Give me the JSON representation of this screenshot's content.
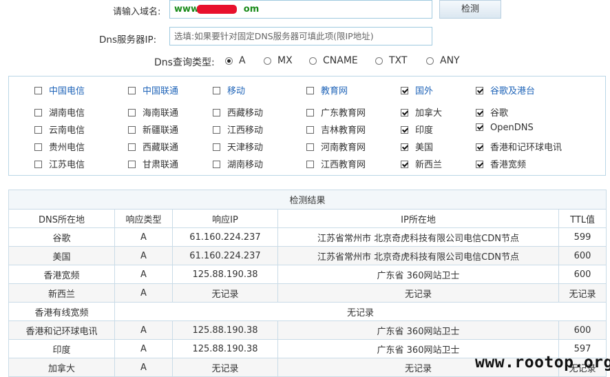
{
  "form": {
    "domain_label": "请输入域名:",
    "domain_value": "www.k",
    "domain_value_suffix": "om",
    "check_button": "检测",
    "dns_label": "Dns服务器IP:",
    "dns_placeholder": "选填:如果要针对固定DNS服务器可填此项(限IP地址)",
    "query_type_label": "Dns查询类型:",
    "query_types": [
      {
        "label": "A",
        "selected": true
      },
      {
        "label": "MX",
        "selected": false
      },
      {
        "label": "CNAME",
        "selected": false
      },
      {
        "label": "TXT",
        "selected": false
      },
      {
        "label": "ANY",
        "selected": false
      }
    ]
  },
  "isp_columns": [
    {
      "head": {
        "label": "中国电信",
        "checked": false
      },
      "items": [
        {
          "label": "湖南电信",
          "checked": false
        },
        {
          "label": "云南电信",
          "checked": false
        },
        {
          "label": "贵州电信",
          "checked": false
        },
        {
          "label": "江苏电信",
          "checked": false
        }
      ]
    },
    {
      "head": {
        "label": "中国联通",
        "checked": false
      },
      "items": [
        {
          "label": "海南联通",
          "checked": false
        },
        {
          "label": "新疆联通",
          "checked": false
        },
        {
          "label": "西藏联通",
          "checked": false
        },
        {
          "label": "甘肃联通",
          "checked": false
        }
      ]
    },
    {
      "head": {
        "label": "移动",
        "checked": false
      },
      "items": [
        {
          "label": "西藏移动",
          "checked": false
        },
        {
          "label": "江西移动",
          "checked": false
        },
        {
          "label": "天津移动",
          "checked": false
        },
        {
          "label": "湖南移动",
          "checked": false
        }
      ]
    },
    {
      "head": {
        "label": "教育网",
        "checked": false
      },
      "items": [
        {
          "label": "广东教育网",
          "checked": false
        },
        {
          "label": "吉林教育网",
          "checked": false
        },
        {
          "label": "河南教育网",
          "checked": false
        },
        {
          "label": "江西教育网",
          "checked": false
        }
      ]
    },
    {
      "head": {
        "label": "国外",
        "checked": true
      },
      "items": [
        {
          "label": "加拿大",
          "checked": true
        },
        {
          "label": "印度",
          "checked": true
        },
        {
          "label": "美国",
          "checked": true
        },
        {
          "label": "新西兰",
          "checked": true
        }
      ]
    },
    {
      "head": {
        "label": "谷歌及港台",
        "checked": true
      },
      "items": [
        {
          "label": "谷歌",
          "checked": true
        },
        {
          "label": "OpenDNS",
          "checked": true
        },
        {
          "label": "香港和记环球电讯",
          "checked": true
        },
        {
          "label": "香港宽频",
          "checked": true
        }
      ]
    }
  ],
  "results": {
    "title": "检测结果",
    "headers": [
      "DNS所在地",
      "响应类型",
      "响应IP",
      "IP所在地",
      "TTL值"
    ],
    "no_record": "无记录",
    "rows": [
      {
        "loc": "谷歌",
        "type": "A",
        "ip": "61.160.224.237",
        "iploc": "江苏省常州市 北京奇虎科技有限公司电信CDN节点",
        "ttl": "599"
      },
      {
        "loc": "美国",
        "type": "A",
        "ip": "61.160.224.237",
        "iploc": "江苏省常州市 北京奇虎科技有限公司电信CDN节点",
        "ttl": "600"
      },
      {
        "loc": "香港宽频",
        "type": "A",
        "ip": "125.88.190.38",
        "iploc": "广东省 360网站卫士",
        "ttl": "600"
      },
      {
        "loc": "新西兰",
        "type": "A",
        "ip": "无记录",
        "iploc": "无记录",
        "ttl": "无记录"
      },
      {
        "loc": "香港有线宽频",
        "merged": "无记录"
      },
      {
        "loc": "香港和记环球电讯",
        "type": "A",
        "ip": "125.88.190.38",
        "iploc": "广东省 360网站卫士",
        "ttl": "600"
      },
      {
        "loc": "印度",
        "type": "A",
        "ip": "125.88.190.38",
        "iploc": "广东省 360网站卫士",
        "ttl": "597"
      },
      {
        "loc": "加拿大",
        "type": "A",
        "ip": "无记录",
        "iploc": "无记录",
        "ttl": "无记录"
      }
    ]
  },
  "watermark": "www.rootop.org",
  "colors": {
    "accent_blue": "#1f64b8",
    "no_record_red": "#c00000",
    "domain_green": "#1a8b1a"
  }
}
